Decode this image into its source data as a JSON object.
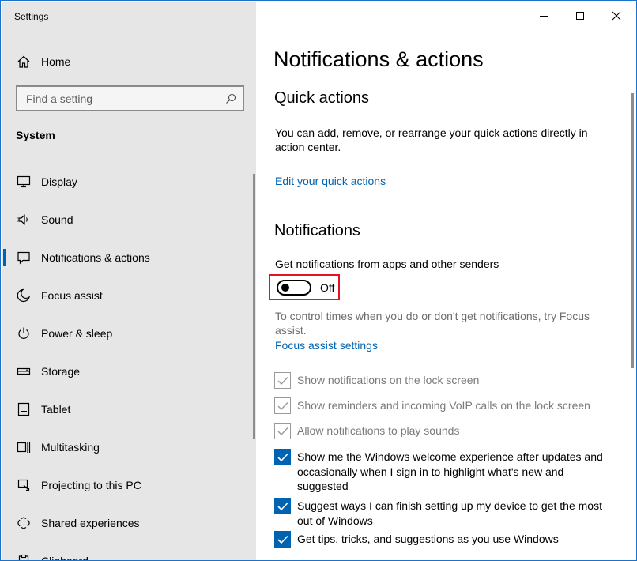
{
  "window": {
    "title": "Settings"
  },
  "sidebar": {
    "home_label": "Home",
    "search_placeholder": "Find a setting",
    "section_label": "System",
    "items": [
      {
        "label": "Display",
        "icon": "monitor-icon"
      },
      {
        "label": "Sound",
        "icon": "speaker-icon"
      },
      {
        "label": "Notifications & actions",
        "icon": "message-icon",
        "selected": true
      },
      {
        "label": "Focus assist",
        "icon": "moon-icon"
      },
      {
        "label": "Power & sleep",
        "icon": "power-icon"
      },
      {
        "label": "Storage",
        "icon": "storage-icon"
      },
      {
        "label": "Tablet",
        "icon": "tablet-icon"
      },
      {
        "label": "Multitasking",
        "icon": "multitasking-icon"
      },
      {
        "label": "Projecting to this PC",
        "icon": "projector-icon"
      },
      {
        "label": "Shared experiences",
        "icon": "shared-icon"
      },
      {
        "label": "Clipboard",
        "icon": "clipboard-icon"
      }
    ]
  },
  "main": {
    "title": "Notifications & actions",
    "quick_actions": {
      "heading": "Quick actions",
      "description": "You can add, remove, or rearrange your quick actions directly in action center.",
      "link": "Edit your quick actions"
    },
    "notifications": {
      "heading": "Notifications",
      "toggle_caption": "Get notifications from apps and other senders",
      "toggle_state": "Off",
      "focus_text": "To control times when you do or don't get notifications, try Focus assist.",
      "focus_link": "Focus assist settings",
      "checkboxes": [
        {
          "label": "Show notifications on the lock screen",
          "checked": true,
          "disabled": true
        },
        {
          "label": "Show reminders and incoming VoIP calls on the lock screen",
          "checked": true,
          "disabled": true
        },
        {
          "label": "Allow notifications to play sounds",
          "checked": true,
          "disabled": true
        },
        {
          "label": "Show me the Windows welcome experience after updates and occasionally when I sign in to highlight what's new and suggested",
          "checked": true,
          "disabled": false
        },
        {
          "label": "Suggest ways I can finish setting up my device to get the most out of Windows",
          "checked": true,
          "disabled": false
        },
        {
          "label": "Get tips, tricks, and suggestions as you use Windows",
          "checked": true,
          "disabled": false
        }
      ]
    }
  },
  "colors": {
    "accent": "#0063b1",
    "highlight_border": "#e81123",
    "sidebar_bg": "#e6e6e6"
  }
}
